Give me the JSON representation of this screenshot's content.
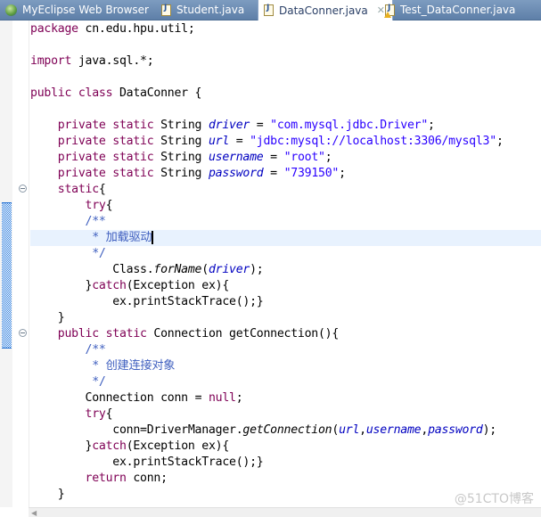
{
  "tabs": [
    {
      "label": "MyEclipse Web Browser",
      "icon": "globe-icon",
      "active": false
    },
    {
      "label": "Student.java",
      "icon": "java-file-icon",
      "active": false
    },
    {
      "label": "DataConner.java",
      "icon": "java-file-icon",
      "active": true,
      "close": "✕"
    },
    {
      "label": "Test_DataConner.java",
      "icon": "java-file-warning-icon",
      "active": false
    }
  ],
  "code": {
    "l1": {
      "kw": "package",
      "rest": " cn.edu.hpu.util;"
    },
    "l3": {
      "kw": "import",
      "rest": " java.sql.*;"
    },
    "l5": {
      "kw": "public class",
      "rest": " DataConner {"
    },
    "fields": [
      {
        "mods": "private static",
        "type": " String ",
        "name": "driver",
        "eq": " = ",
        "value": "\"com.mysql.jdbc.Driver\"",
        "end": ";"
      },
      {
        "mods": "private static",
        "type": " String ",
        "name": "url",
        "eq": " = ",
        "value": "\"jdbc:mysql://localhost:3306/mysql3\"",
        "end": ";"
      },
      {
        "mods": "private static",
        "type": " String ",
        "name": "username",
        "eq": " = ",
        "value": "\"root\"",
        "end": ";"
      },
      {
        "mods": "private static",
        "type": " String ",
        "name": "password",
        "eq": " = ",
        "value": "\"739150\"",
        "end": ";"
      }
    ],
    "static_kw": "static",
    "brace_open": "{",
    "try_kw": "try",
    "catch_kw": "catch",
    "comment_open": "/**",
    "comment_star": " * ",
    "comment_close": " */",
    "comment1_text": "加载驱动",
    "forname_pre": "Class.",
    "forname_method": "forName",
    "forname_arg": "driver",
    "forname_end": ");",
    "catch_rest": "(Exception ex){",
    "print_stack": "ex.printStackTrace();}",
    "close_brace": "}",
    "method_kw": "public static",
    "method_rest": " Connection getConnection(){",
    "comment2_text": "创建连接对象",
    "conn_decl": "Connection conn = ",
    "null_kw": "null",
    "semicolon": ";",
    "getconn_pre": "conn=DriverManager.",
    "getconn_method": "getConnection",
    "arg_url": "url",
    "arg_username": "username",
    "arg_password": "password",
    "return_kw": "return",
    "return_rest": " conn;"
  },
  "watermark": "@51CTO博客"
}
